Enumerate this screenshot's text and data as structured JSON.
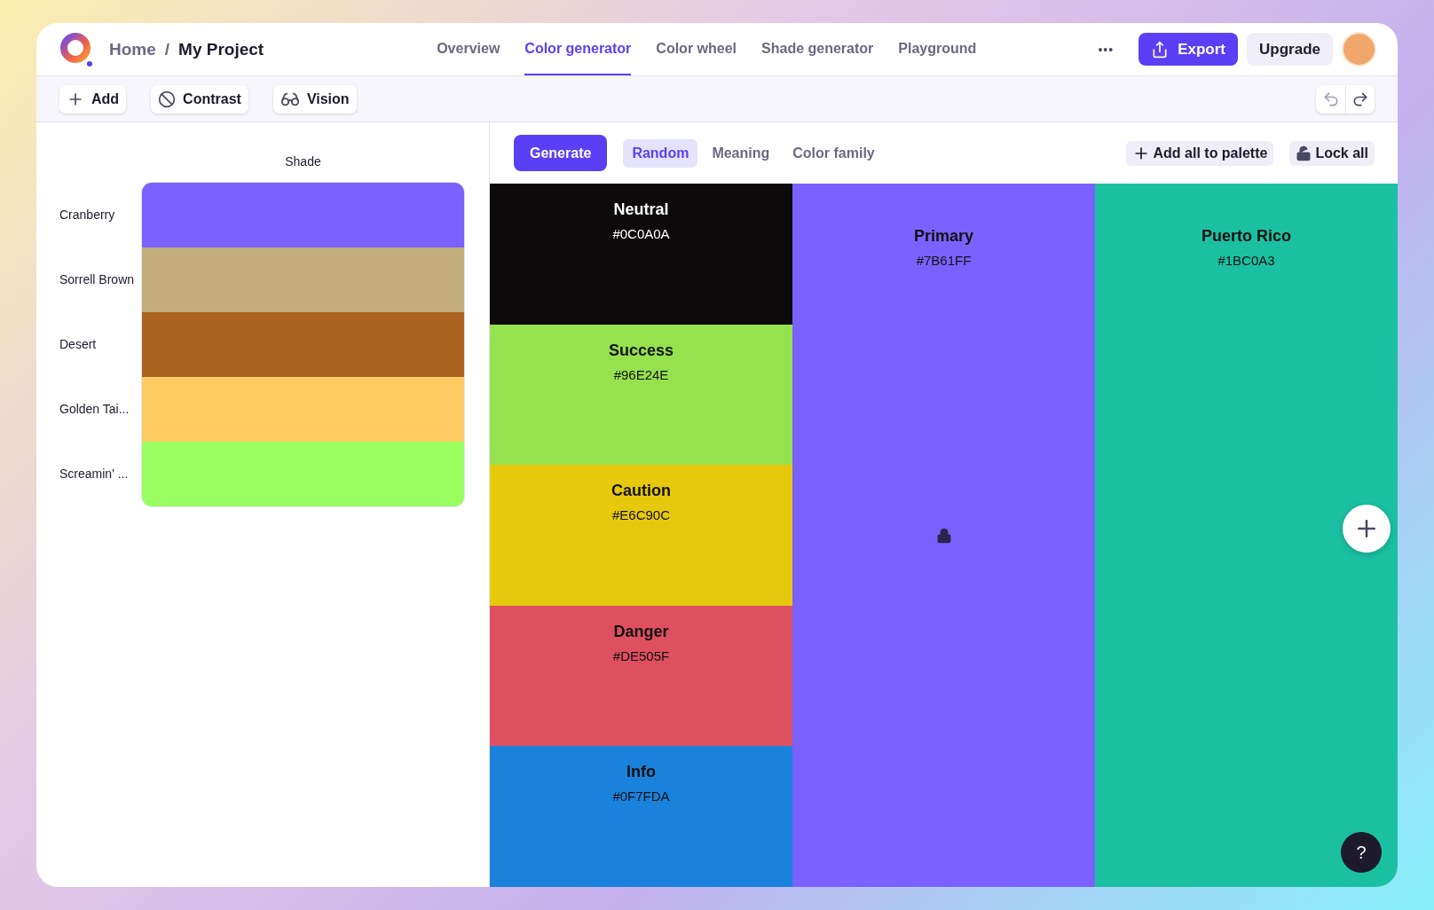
{
  "breadcrumb": {
    "home": "Home",
    "separator": "/",
    "project": "My Project"
  },
  "nav_tabs": [
    {
      "label": "Overview",
      "selected": false
    },
    {
      "label": "Color generator",
      "selected": true
    },
    {
      "label": "Color wheel",
      "selected": false
    },
    {
      "label": "Shade generator",
      "selected": false
    },
    {
      "label": "Playground",
      "selected": false
    }
  ],
  "header_actions": {
    "more": "•••",
    "export": "Export",
    "upgrade": "Upgrade"
  },
  "toolbar": [
    {
      "kind": "add",
      "label": "Add"
    },
    {
      "kind": "contrast",
      "label": "Contrast"
    },
    {
      "kind": "vision",
      "label": "Vision"
    }
  ],
  "shade_panel": {
    "title": "Shade",
    "rows": [
      {
        "name": "Cranberry",
        "color": "#7b61ff"
      },
      {
        "name": "Sorrell Brown",
        "color": "#c4ad7c"
      },
      {
        "name": "Desert",
        "color": "#ab621f"
      },
      {
        "name": "Golden Tai...",
        "color": "#fecb63"
      },
      {
        "name": "Screamin' ...",
        "color": "#99ff61"
      }
    ]
  },
  "generator": {
    "generate": "Generate",
    "modes": [
      {
        "label": "Random",
        "selected": true
      },
      {
        "label": "Meaning",
        "selected": false
      },
      {
        "label": "Color family",
        "selected": false
      }
    ],
    "add_all": "Add all to palette",
    "lock_all": "Lock all"
  },
  "columns": [
    {
      "kind": "stack",
      "swatches": [
        {
          "name": "Neutral",
          "hex": "#0C0A0A",
          "color": "#0c0a0a"
        },
        {
          "name": "Success",
          "hex": "#96E24E",
          "color": "#96e24e"
        },
        {
          "name": "Caution",
          "hex": "#E6C90C",
          "color": "#e6c90c"
        },
        {
          "name": "Danger",
          "hex": "#DE505F",
          "color": "#de505f"
        },
        {
          "name": "Info",
          "hex": "#0F7FDA",
          "color": "#1b82dc"
        }
      ]
    },
    {
      "kind": "single",
      "name": "Primary",
      "hex": "#7B61FF",
      "color": "#7b61ff",
      "locked": true
    },
    {
      "kind": "single",
      "name": "Puerto Rico",
      "hex": "#1BC0A3",
      "color": "#1bc0a3",
      "locked": false
    }
  ],
  "help": "?"
}
